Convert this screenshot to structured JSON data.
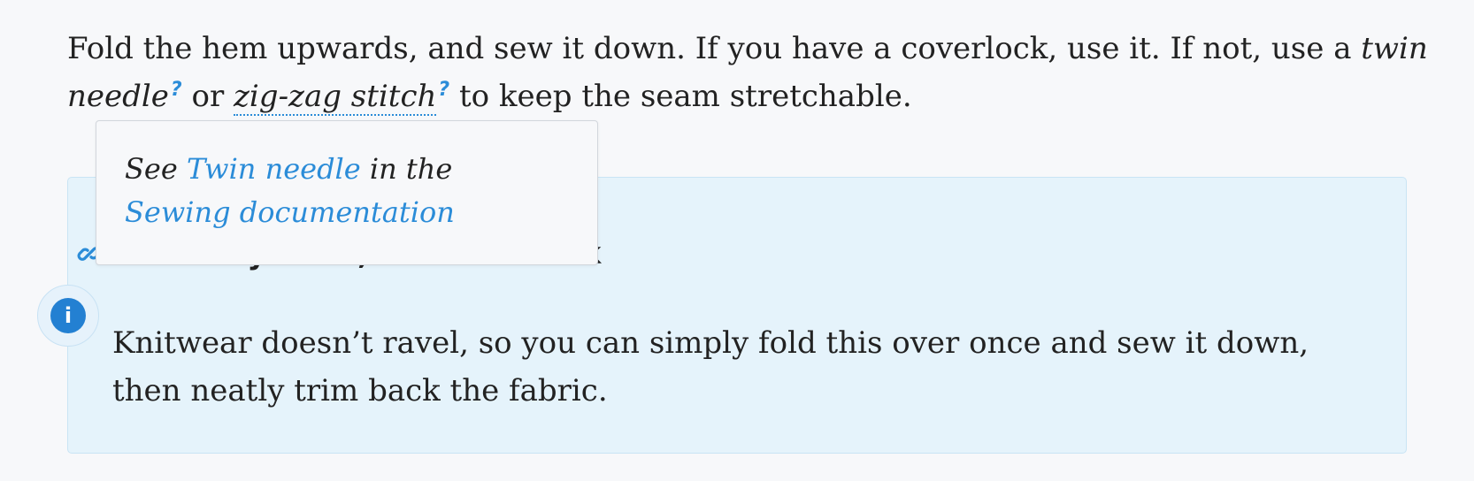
{
  "intro": {
    "part1": "Fold the hem upwards, and sew it down. If you have a coverlock, use it. If not, use a ",
    "term1": "twin needle",
    "term_marker": "?",
    "between": " or ",
    "term2": "zig-zag stitch",
    "part2": " to keep the seam stretchable."
  },
  "note": {
    "title": "Fold only once, to avoid bulk",
    "text": "Knitwear doesn’t ravel, so you can simply fold this over once and sew it down, then neatly trim back the fabric.",
    "info_glyph": "i"
  },
  "tooltip": {
    "see": "See ",
    "link1": "Twin needle",
    "middle": " in the ",
    "link2": "Sewing documentation"
  },
  "icons": {
    "anchor": "link-icon",
    "info": "info-icon"
  },
  "colors": {
    "accent": "#2b8cd8",
    "note_background": "#e5f3fb",
    "info_badge": "#2380d2",
    "text": "#222222"
  }
}
